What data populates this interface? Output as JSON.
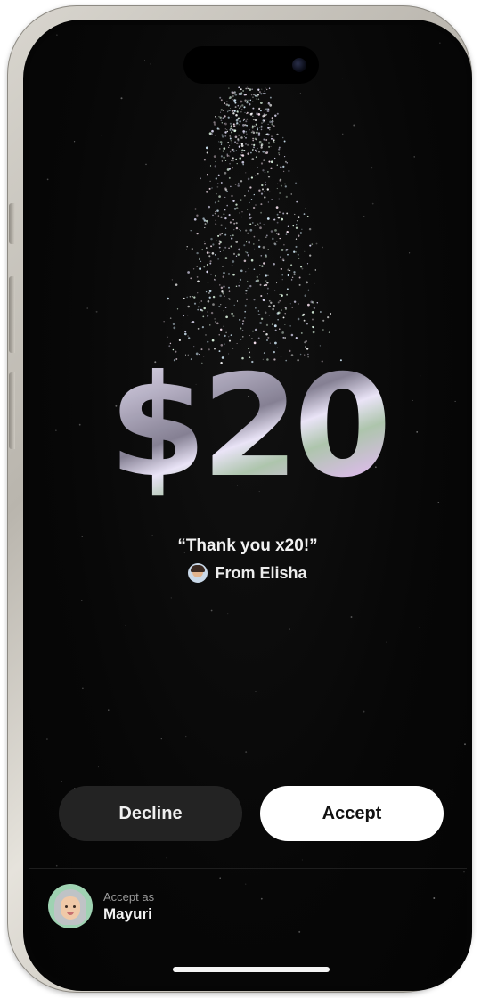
{
  "payment": {
    "amount": "$20",
    "message": "“Thank you x20!”",
    "from_label": "From Elisha"
  },
  "actions": {
    "decline_label": "Decline",
    "accept_label": "Accept"
  },
  "account": {
    "subtitle": "Accept as",
    "name": "Mayuri"
  }
}
